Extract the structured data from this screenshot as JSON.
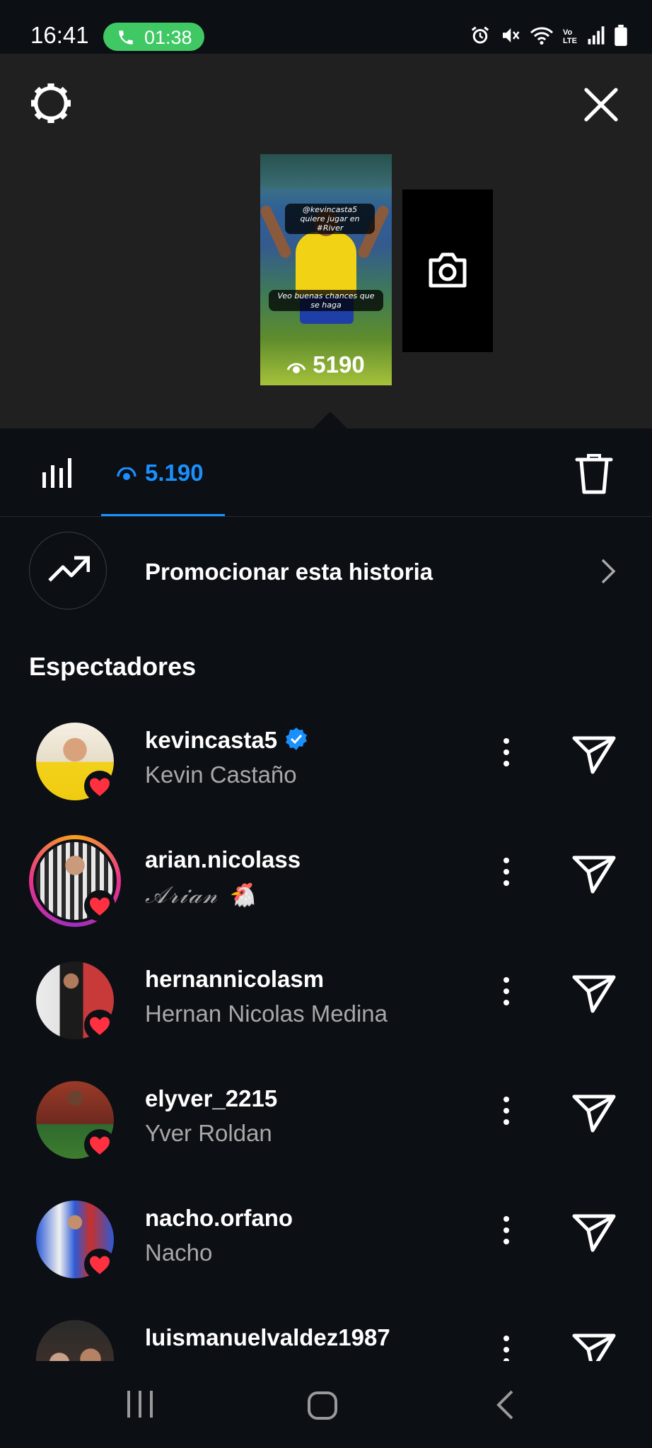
{
  "status_bar": {
    "time": "16:41",
    "call_duration": "01:38",
    "icons": [
      "alarm-icon",
      "mute-icon",
      "wifi-icon",
      "volte-icon",
      "signal-icon",
      "battery-icon"
    ],
    "volte_label": "Vo\nLTE"
  },
  "story": {
    "overlay_text_1": "@kevincasta5 quiere jugar en #River",
    "overlay_text_2": "Veo buenas chances que se haga",
    "thumb_views": "5190"
  },
  "tabs": {
    "views_count": "5.190",
    "accent": "#1a90ff"
  },
  "promo": {
    "label": "Promocionar esta historia"
  },
  "section_title": "Espectadores",
  "viewers": [
    {
      "username": "kevincasta5",
      "fullname": "Kevin Castaño",
      "verified": true
    },
    {
      "username": "arian.nicolass",
      "fullname": "𝒜𝓇𝒾𝒶𝓃 🐔",
      "verified": false
    },
    {
      "username": "hernannicolasm",
      "fullname": "Hernan Nicolas Medina",
      "verified": false
    },
    {
      "username": "elyver_2215",
      "fullname": "Yver Roldan",
      "verified": false
    },
    {
      "username": "nacho.orfano",
      "fullname": "Nacho",
      "verified": false
    },
    {
      "username": "luismanuelvaldez1987",
      "fullname": "",
      "verified": false
    }
  ],
  "colors": {
    "background": "#0c0f14",
    "top_area": "#202020",
    "heart": "#ff3040",
    "call_pill": "#3fc864",
    "muted_text": "#a8a8a8"
  }
}
